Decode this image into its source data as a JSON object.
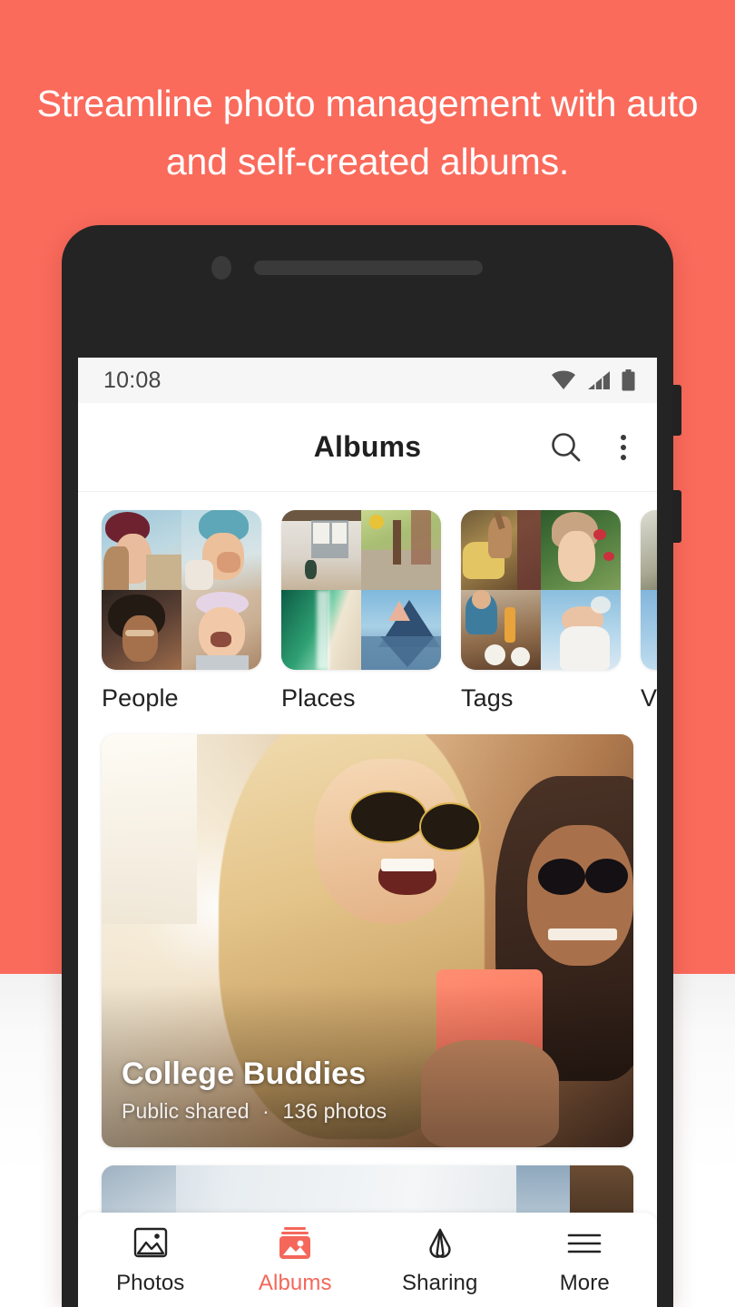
{
  "headline": "Streamline photo management with auto and self-created albums.",
  "theme": {
    "coral": "#FA6B5C",
    "accent": "#F4675A",
    "page_background": "#FFFFFF",
    "status_bar_background": "#F6F6F6",
    "text_primary": "#202020"
  },
  "phone": {
    "status_bar": {
      "time": "10:08",
      "icons": [
        "wifi-icon",
        "cellular-signal-icon",
        "battery-icon"
      ]
    },
    "app_bar": {
      "title": "Albums",
      "search_icon": "search-icon",
      "overflow_icon": "more-vertical-icon"
    },
    "categories": [
      {
        "label": "People"
      },
      {
        "label": "Places"
      },
      {
        "label": "Tags"
      },
      {
        "label": "V"
      }
    ],
    "albums": [
      {
        "title": "College Buddies",
        "visibility": "Public shared",
        "separator": "·",
        "count": "136 photos"
      }
    ],
    "bottom_nav": [
      {
        "label": "Photos",
        "icon": "photo-frame-icon",
        "active": false
      },
      {
        "label": "Albums",
        "icon": "albums-stack-icon",
        "active": true
      },
      {
        "label": "Sharing",
        "icon": "sharing-loops-icon",
        "active": false
      },
      {
        "label": "More",
        "icon": "hamburger-menu-icon",
        "active": false
      }
    ]
  }
}
